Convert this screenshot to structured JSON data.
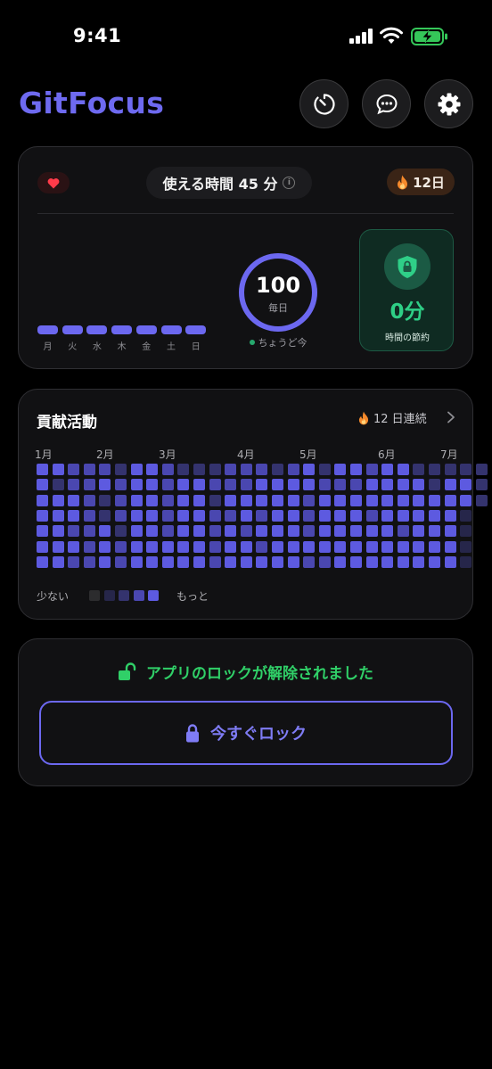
{
  "status_bar": {
    "time": "9:41"
  },
  "header": {
    "app_title": "GitFocus",
    "icons": [
      "timer-icon",
      "chat-icon",
      "gear-icon"
    ]
  },
  "focus_card": {
    "available_time": "使える時間 45 分",
    "streak_days": "12日",
    "weekdays": [
      "月",
      "火",
      "水",
      "木",
      "金",
      "土",
      "日"
    ],
    "goal_value": "100",
    "goal_unit": "毎日",
    "goal_note": "ちょうど今",
    "goal_progress": 1.0,
    "saved_value": "0分",
    "saved_label": "時間の節約"
  },
  "contrib_card": {
    "title": "貢献活動",
    "streak": "12 日連続",
    "months": [
      "1月",
      "2月",
      "3月",
      "4月",
      "5月",
      "6月",
      "7月"
    ],
    "legend_less": "少ない",
    "legend_more": "もっと",
    "levels": [
      [
        5,
        5,
        4,
        4,
        4,
        3,
        5,
        5,
        4,
        3,
        3,
        3,
        4,
        4,
        4,
        3,
        4,
        5,
        3,
        5,
        5,
        4,
        5,
        5,
        3,
        3,
        3,
        3,
        3
      ],
      [
        5,
        3,
        4,
        4,
        5,
        4,
        5,
        5,
        4,
        5,
        5,
        4,
        4,
        4,
        5,
        5,
        5,
        5,
        4,
        4,
        4,
        5,
        5,
        5,
        5,
        3,
        5,
        5,
        3
      ],
      [
        5,
        5,
        5,
        4,
        3,
        4,
        5,
        5,
        4,
        5,
        5,
        3,
        5,
        5,
        5,
        5,
        5,
        4,
        5,
        5,
        5,
        5,
        5,
        5,
        5,
        5,
        5,
        5,
        3
      ],
      [
        5,
        5,
        5,
        4,
        3,
        4,
        5,
        5,
        4,
        5,
        5,
        4,
        4,
        5,
        4,
        5,
        5,
        4,
        5,
        5,
        5,
        4,
        5,
        5,
        5,
        5,
        5,
        2
      ],
      [
        5,
        5,
        4,
        4,
        5,
        3,
        5,
        5,
        4,
        5,
        5,
        4,
        5,
        4,
        5,
        5,
        5,
        4,
        5,
        5,
        5,
        5,
        5,
        4,
        5,
        5,
        5,
        2
      ],
      [
        5,
        5,
        5,
        4,
        5,
        4,
        5,
        5,
        5,
        5,
        5,
        4,
        5,
        5,
        4,
        5,
        5,
        5,
        5,
        5,
        5,
        5,
        5,
        5,
        5,
        5,
        5,
        2
      ],
      [
        5,
        5,
        4,
        4,
        5,
        4,
        5,
        5,
        5,
        5,
        5,
        4,
        5,
        5,
        5,
        5,
        5,
        4,
        4,
        5,
        5,
        5,
        5,
        5,
        5,
        5,
        5,
        2
      ]
    ],
    "level_colors": [
      "#2c2c2e",
      "#2c2c2e",
      "#26264a",
      "#34336e",
      "#4a47b0",
      "#5d5ae0"
    ]
  },
  "lock_card": {
    "status": "アプリのロックが解除されました",
    "lock_button": "今すぐロック"
  },
  "colors": {
    "accent": "#6c68f0",
    "success": "#30d068",
    "saved": "#2ecf86",
    "flame": "#f5892b",
    "heart": "#ff3b4a"
  }
}
